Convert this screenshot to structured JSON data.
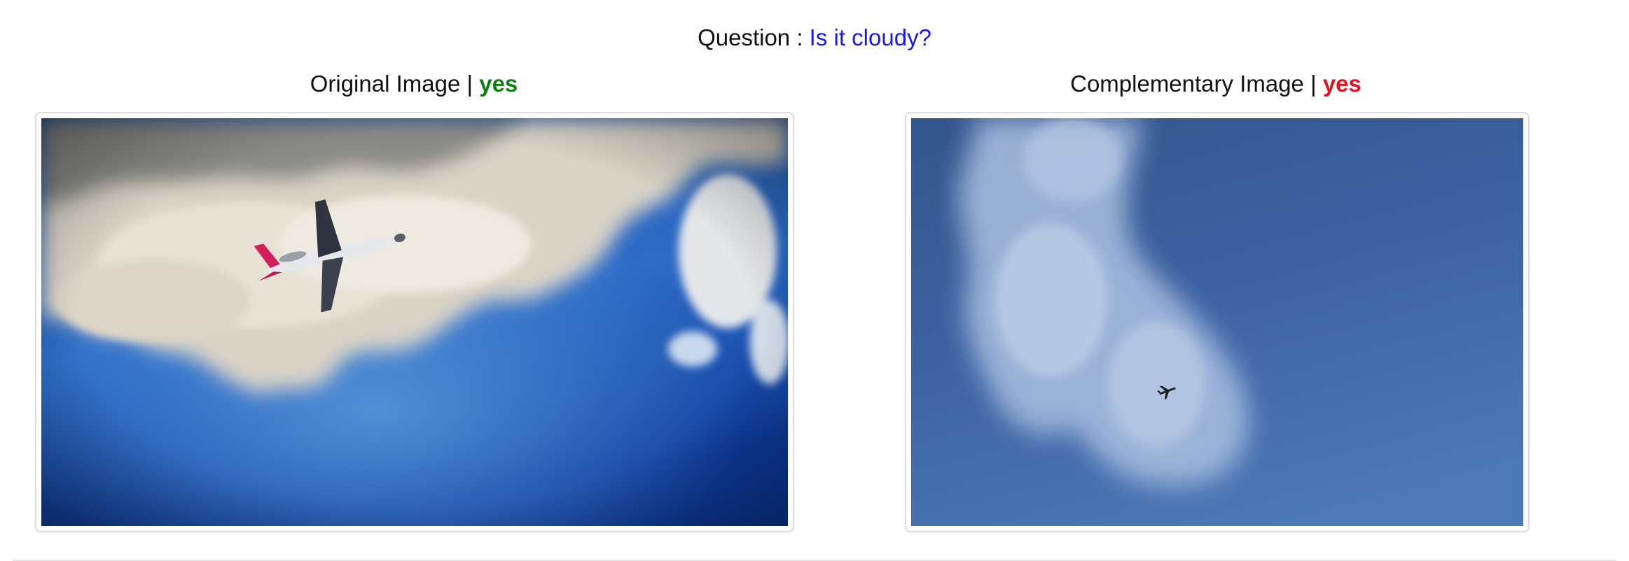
{
  "question": {
    "prefix": "Question : ",
    "text": "Is it cloudy?"
  },
  "original": {
    "title": "Original Image | ",
    "answer": "yes",
    "answer_color": "#118011"
  },
  "complementary": {
    "title": "Complementary Image | ",
    "answer": "yes",
    "answer_color": "#e0141e"
  },
  "colors": {
    "question_text": "#1a1ae6",
    "sky_deep": "#0a3a9a",
    "sky_soft": "#4872b0"
  }
}
